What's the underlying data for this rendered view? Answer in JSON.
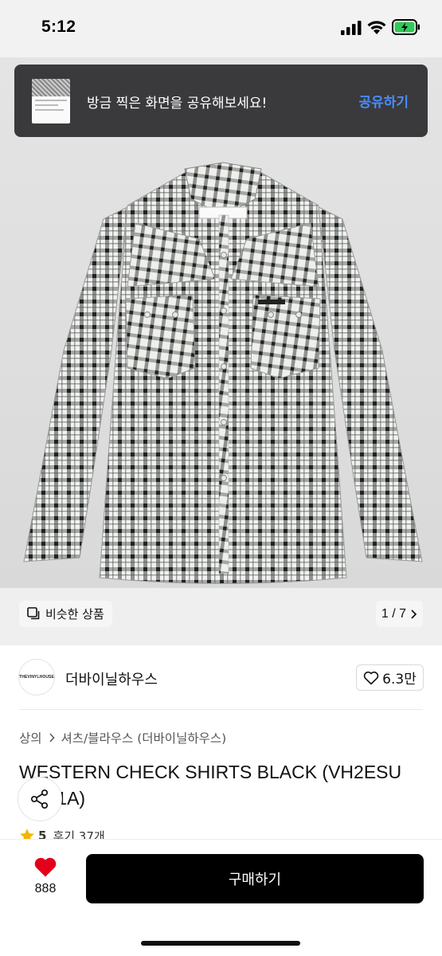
{
  "status_bar": {
    "time": "5:12"
  },
  "toast": {
    "message": "방금 찍은 화면을 공유해보세요!",
    "action": "공유하기"
  },
  "gallery": {
    "similar_label": "비슷한 상품",
    "page_counter": "1 / 7"
  },
  "seller": {
    "logo_text": "THEVINYLHOUSE",
    "name": "더바이닐하우스",
    "likes": "6.3만"
  },
  "breadcrumb": {
    "category": "상의",
    "subcategory": "셔츠/블라우스 (더바이닐하우스)"
  },
  "product": {
    "title": "WESTERN CHECK SHIRTS BLACK (VH2ESU W__1A)",
    "rating": "5",
    "reviews": "후기 37개"
  },
  "bottom": {
    "wish_count": "888",
    "buy_label": "구매하기"
  },
  "icons": [
    "signal-icon",
    "wifi-icon",
    "battery-charging-icon",
    "copy-icon",
    "chevron-right-icon",
    "heart-outline-icon",
    "share-icon",
    "star-icon",
    "heart-filled-icon"
  ],
  "colors": {
    "accent_link": "#4a8cff",
    "toast_bg": "#3a3a3c",
    "buy_button": "#000000",
    "wish_heart": "#e3001b",
    "battery": "#34c759",
    "star": "#f2b600"
  }
}
